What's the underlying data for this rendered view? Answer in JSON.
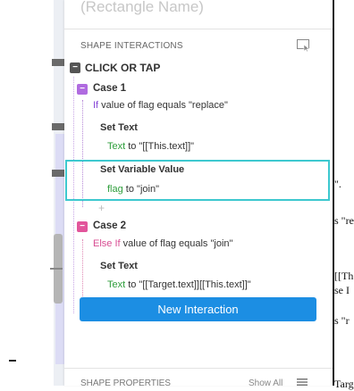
{
  "panel": {
    "rect_name_placeholder": "(Rectangle Name)",
    "shape_interactions_label": "SHAPE INTERACTIONS",
    "event_label": "CLICK OR TAP",
    "cases": [
      {
        "title": "Case 1",
        "condition_keyword": "If",
        "condition_text": " value of flag equals \"replace\"",
        "actions": [
          {
            "label": "Set Text",
            "detail_keyword": "Text",
            "detail_text": " to \"[[This.text]]\""
          },
          {
            "label": "Set Variable Value",
            "detail_keyword": "flag",
            "detail_text": " to \"join\""
          }
        ]
      },
      {
        "title": "Case 2",
        "condition_keyword": "Else If",
        "condition_text": " value of flag equals \"join\"",
        "actions": [
          {
            "label": "Set Text",
            "detail_keyword": "Text",
            "detail_text": " to \"[[Target.text]][[This.text]]\""
          }
        ]
      }
    ],
    "new_interaction_label": "New Interaction",
    "shape_properties_label": "SHAPE PROPERTIES",
    "show_all_label": "Show All"
  },
  "background_doc": {
    "fragments": [
      "\".",
      "s \"re",
      "[[Th",
      "se I",
      "s \"r",
      "Targ"
    ]
  },
  "colors": {
    "accent_blue": "#1c8ee3",
    "case1_purple": "#b06be0",
    "case2_pink": "#e2559b",
    "highlight_teal": "#3dc8cf",
    "action_green": "#2f9e3c"
  },
  "icons": {
    "interaction_cursor": "cursor-select-icon",
    "collapse": "minus-icon",
    "add": "plus-icon",
    "menu": "hamburger-icon"
  }
}
